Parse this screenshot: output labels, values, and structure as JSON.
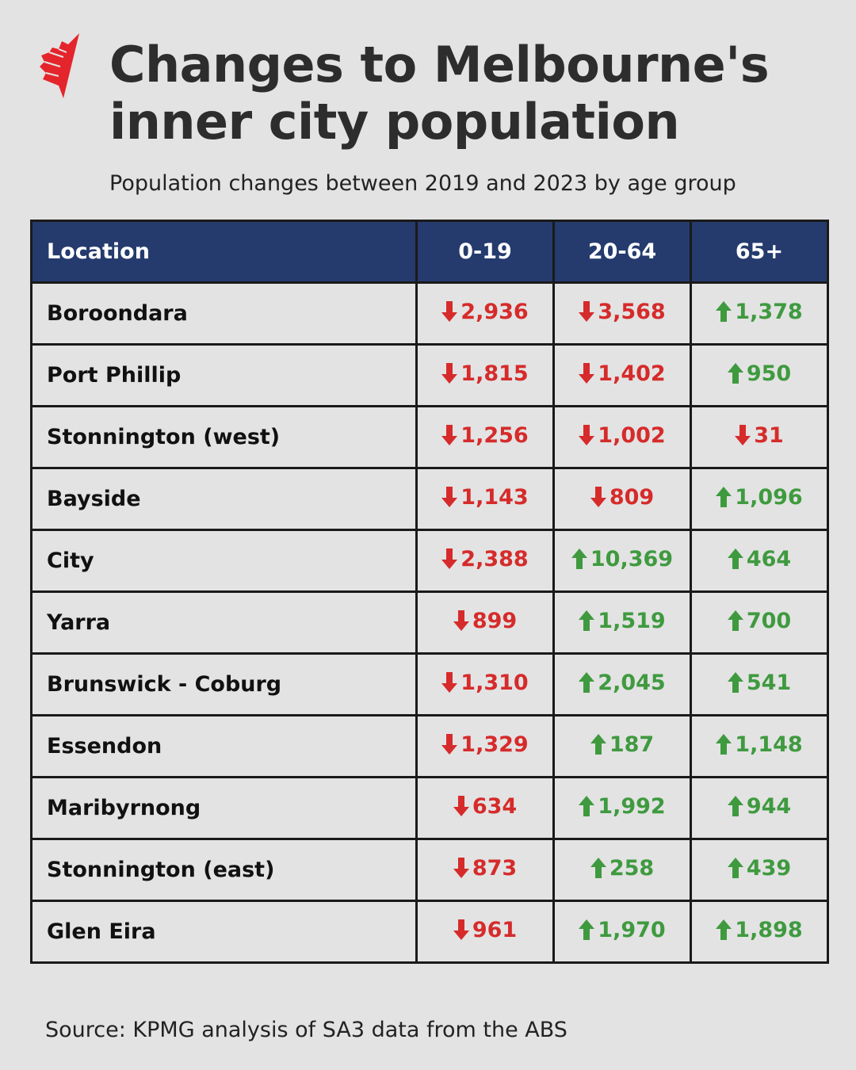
{
  "brand": {
    "logo_icon": "sbs-logo-icon",
    "logo_color": "#e4252b"
  },
  "header": {
    "title_line1": "Changes to Melbourne's",
    "title_line2": "inner city population",
    "subtitle": "Population changes between 2019 and 2023 by age group"
  },
  "colors": {
    "header_bg": "#253b6e",
    "decrease": "#d62b2b",
    "increase": "#3f9a3f",
    "background": "#e3e3e3"
  },
  "chart_data": {
    "type": "table",
    "title": "Changes to Melbourne's inner city population",
    "subtitle": "Population changes between 2019 and 2023 by age group",
    "columns": [
      "Location",
      "0-19",
      "20-64",
      "65+"
    ],
    "rows": [
      {
        "location": "Boroondara",
        "values": [
          -2936,
          -3568,
          1378
        ],
        "labels": [
          "2,936",
          "3,568",
          "1,378"
        ]
      },
      {
        "location": "Port Phillip",
        "values": [
          -1815,
          -1402,
          950
        ],
        "labels": [
          "1,815",
          "1,402",
          "950"
        ]
      },
      {
        "location": "Stonnington (west)",
        "values": [
          -1256,
          -1002,
          -31
        ],
        "labels": [
          "1,256",
          "1,002",
          "31"
        ]
      },
      {
        "location": "Bayside",
        "values": [
          -1143,
          -809,
          1096
        ],
        "labels": [
          "1,143",
          "809",
          "1,096"
        ]
      },
      {
        "location": "City",
        "values": [
          -2388,
          10369,
          464
        ],
        "labels": [
          "2,388",
          "10,369",
          "464"
        ]
      },
      {
        "location": "Yarra",
        "values": [
          -899,
          1519,
          700
        ],
        "labels": [
          "899",
          "1,519",
          "700"
        ]
      },
      {
        "location": "Brunswick - Coburg",
        "values": [
          -1310,
          2045,
          541
        ],
        "labels": [
          "1,310",
          "2,045",
          "541"
        ]
      },
      {
        "location": "Essendon",
        "values": [
          -1329,
          187,
          1148
        ],
        "labels": [
          "1,329",
          "187",
          "1,148"
        ]
      },
      {
        "location": "Maribyrnong",
        "values": [
          -634,
          1992,
          944
        ],
        "labels": [
          "634",
          "1,992",
          "944"
        ]
      },
      {
        "location": "Stonnington (east)",
        "values": [
          -873,
          258,
          439
        ],
        "labels": [
          "873",
          "258",
          "439"
        ]
      },
      {
        "location": "Glen Eira",
        "values": [
          -961,
          1970,
          1898
        ],
        "labels": [
          "961",
          "1,970",
          "1,898"
        ]
      }
    ],
    "indicator_icons": {
      "increase": "arrow-up-icon",
      "decrease": "arrow-down-icon"
    }
  },
  "footer": {
    "source": "Source: KPMG analysis of SA3 data from the ABS"
  }
}
